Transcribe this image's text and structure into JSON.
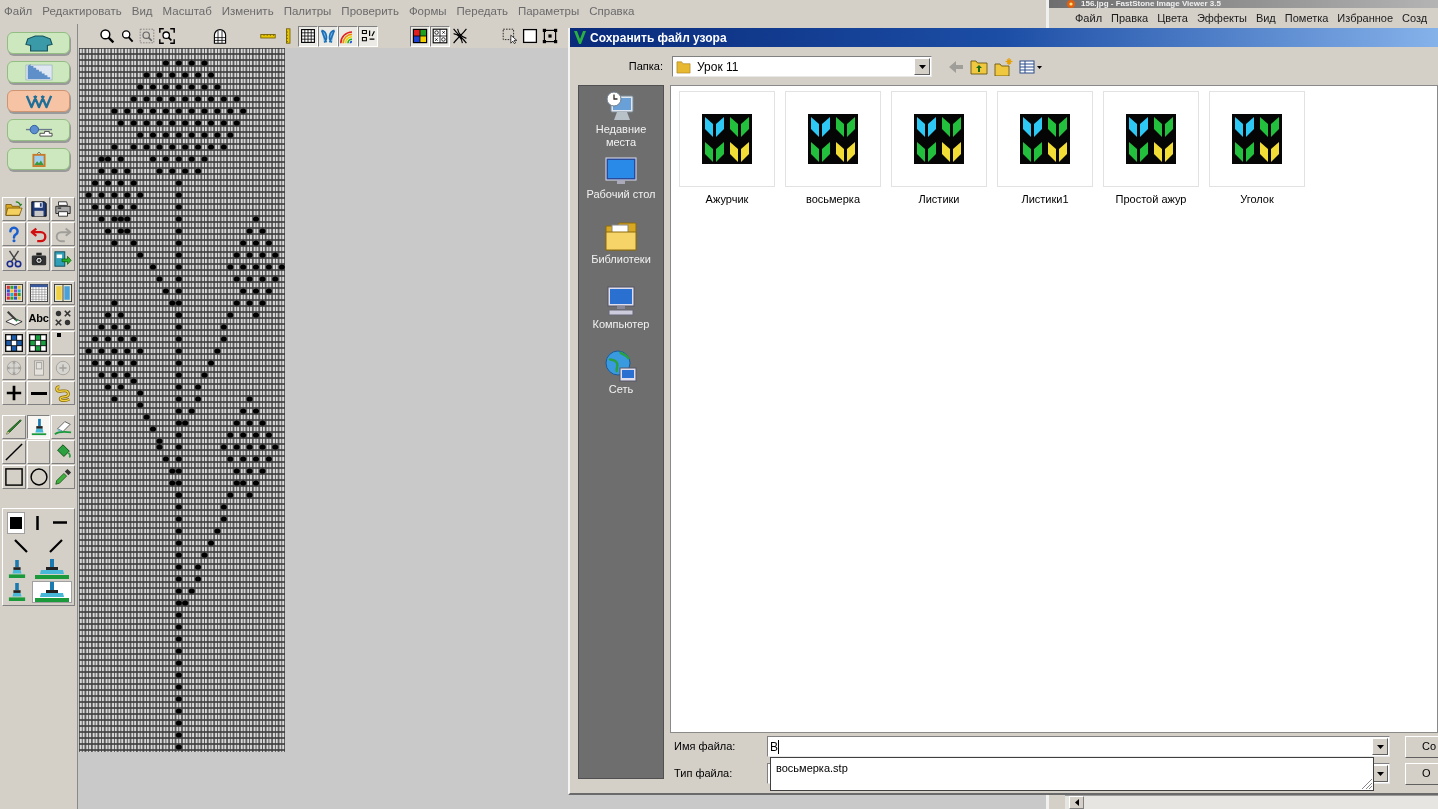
{
  "app": {
    "menu": [
      "Файл",
      "Редактировать",
      "Вид",
      "Масштаб",
      "Изменить",
      "Палитры",
      "Проверить",
      "Формы",
      "Передать",
      "Параметры",
      "Справка"
    ],
    "toolbar": [
      [
        {
          "kind": "zoom-in",
          "pressed": false
        },
        {
          "kind": "zoom-out",
          "pressed": false
        },
        {
          "kind": "zoom-area",
          "pressed": false
        },
        {
          "kind": "zoom-fit",
          "pressed": false
        }
      ],
      [
        {
          "kind": "arch",
          "pressed": false
        }
      ],
      [
        {
          "kind": "ruler-h",
          "pressed": false
        },
        {
          "kind": "ruler-v",
          "pressed": false
        },
        {
          "kind": "grid",
          "pressed": true
        },
        {
          "kind": "motif",
          "pressed": true
        },
        {
          "kind": "rainbow",
          "pressed": true
        },
        {
          "kind": "counter",
          "pressed": true
        }
      ],
      [
        {
          "kind": "colors",
          "pressed": true
        },
        {
          "kind": "dot-grid",
          "pressed": true
        },
        {
          "kind": "cross",
          "pressed": false
        }
      ],
      [
        {
          "kind": "select",
          "pressed": false
        },
        {
          "kind": "square",
          "pressed": false
        },
        {
          "kind": "handles",
          "pressed": false
        }
      ]
    ],
    "modes": [
      {
        "kind": "garment",
        "selected": false
      },
      {
        "kind": "chart",
        "selected": false
      },
      {
        "kind": "stitches",
        "selected": true
      },
      {
        "kind": "machine",
        "selected": false
      },
      {
        "kind": "picture",
        "selected": false
      }
    ],
    "tool_groups": [
      {
        "kind": "raised",
        "rows": [
          [
            {
              "kind": "open",
              "selected": false,
              "disabled": false
            },
            {
              "kind": "save",
              "selected": false,
              "disabled": false
            },
            {
              "kind": "print",
              "selected": false,
              "disabled": false
            }
          ],
          [
            {
              "kind": "help",
              "selected": false,
              "disabled": false
            },
            {
              "kind": "undo",
              "selected": false,
              "disabled": false
            },
            {
              "kind": "redo",
              "selected": false,
              "disabled": true
            }
          ],
          [
            {
              "kind": "cut",
              "selected": false,
              "disabled": false
            },
            {
              "kind": "camera",
              "selected": false,
              "disabled": false
            },
            {
              "kind": "export",
              "selected": false,
              "disabled": false
            }
          ]
        ]
      },
      {
        "kind": "raised",
        "rows": [
          [
            {
              "kind": "color-chart",
              "selected": false,
              "disabled": false
            },
            {
              "kind": "grid-window",
              "selected": false,
              "disabled": false
            },
            {
              "kind": "split-chart",
              "selected": false,
              "disabled": false
            }
          ],
          [
            {
              "kind": "pen-paper",
              "selected": false,
              "disabled": false
            },
            {
              "kind": "text",
              "label": "Abc",
              "selected": false,
              "disabled": false
            },
            {
              "kind": "symbols",
              "selected": false,
              "disabled": false
            }
          ],
          [
            {
              "kind": "blue-grid",
              "selected": false,
              "disabled": false
            },
            {
              "kind": "green-grid",
              "selected": false,
              "disabled": false
            },
            {
              "kind": "dot",
              "selected": false,
              "disabled": false
            }
          ],
          [
            {
              "kind": "move",
              "selected": false,
              "disabled": true
            },
            {
              "kind": "frame",
              "selected": false,
              "disabled": true
            },
            {
              "kind": "zoom-arrows",
              "selected": false,
              "disabled": true
            }
          ],
          [
            {
              "kind": "plus",
              "selected": false,
              "disabled": false
            },
            {
              "kind": "minus",
              "selected": false,
              "disabled": false
            },
            {
              "kind": "lasso",
              "selected": false,
              "disabled": false
            }
          ]
        ]
      },
      {
        "kind": "raised",
        "rows": [
          [
            {
              "kind": "pencil",
              "selected": false,
              "disabled": false
            },
            {
              "kind": "brush",
              "selected": true,
              "disabled": false
            },
            {
              "kind": "eraser",
              "selected": false,
              "disabled": false
            }
          ],
          [
            {
              "kind": "line",
              "selected": false,
              "disabled": false
            },
            {
              "kind": "blank",
              "selected": false
            },
            {
              "kind": "fill",
              "selected": false,
              "disabled": false
            }
          ],
          [
            {
              "kind": "rect",
              "selected": false,
              "disabled": false
            },
            {
              "kind": "ellipse",
              "selected": false,
              "disabled": false
            },
            {
              "kind": "picker",
              "selected": false,
              "disabled": false
            }
          ]
        ]
      },
      {
        "kind": "panel",
        "rows": [
          [
            {
              "kind": "fill-square",
              "selected": true,
              "disabled": false
            },
            {
              "kind": "vline",
              "selected": false,
              "disabled": false
            },
            {
              "kind": "hline",
              "selected": false,
              "disabled": false
            }
          ],
          [
            {
              "kind": "diag-l",
              "selected": false,
              "disabled": false
            },
            {
              "kind": "diag-r",
              "selected": false,
              "disabled": false
            }
          ],
          [
            {
              "kind": "brush-small",
              "selected": false,
              "disabled": false
            },
            {
              "kind": "brush-wide",
              "selected": false,
              "disabled": false
            }
          ],
          [
            {
              "kind": "brush-small",
              "selected": false,
              "disabled": false
            },
            {
              "kind": "brush-wide",
              "selected": true,
              "disabled": false
            }
          ]
        ]
      }
    ]
  },
  "viewer": {
    "title": "156.jpg - FastStone Image Viewer 3.5",
    "menu": [
      "Файл",
      "Правка",
      "Цвета",
      "Эффекты",
      "Вид",
      "Пометка",
      "Избранное",
      "Созд"
    ]
  },
  "dialog": {
    "title": "Сохранить файл узора",
    "folder_label": "Папка:",
    "folder": "Урок 11",
    "toolbar": [
      {
        "kind": "back",
        "disabled": true
      },
      {
        "kind": "up",
        "disabled": false
      },
      {
        "kind": "new-folder",
        "disabled": false
      },
      {
        "kind": "views",
        "disabled": false
      }
    ],
    "places": [
      {
        "kind": "recent",
        "label": "Недавние места"
      },
      {
        "kind": "desktop",
        "label": "Рабочий стол"
      },
      {
        "kind": "libraries",
        "label": "Библиотеки"
      },
      {
        "kind": "computer",
        "label": "Компьютер"
      },
      {
        "kind": "network",
        "label": "Сеть"
      }
    ],
    "files": [
      "Ажурчик",
      "восьмерка",
      "Листики",
      "Листики1",
      "Простой ажур",
      "Уголок"
    ],
    "file_name_label": "Имя файла:",
    "file_name": "В",
    "suggestions": [
      "восьмерка.stp"
    ],
    "file_type_label": "Тип файла:",
    "buttons": [
      "Со",
      "О"
    ]
  }
}
